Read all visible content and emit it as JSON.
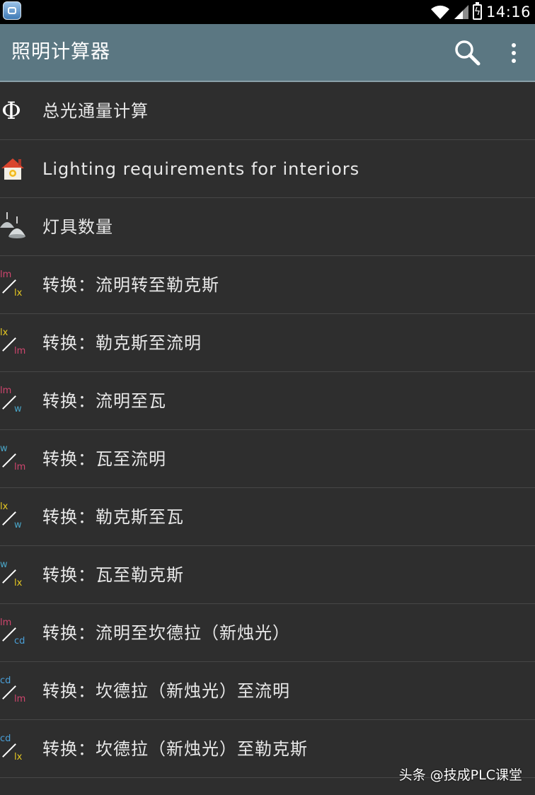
{
  "status_bar": {
    "time": "14:16"
  },
  "action_bar": {
    "title": "照明计算器"
  },
  "colors": {
    "lm": "#d0466e",
    "lx": "#e6c822",
    "w": "#4aa6c8",
    "cd": "#4a9fd8"
  },
  "items": [
    {
      "label": "总光通量计算",
      "icon": "phi-icon"
    },
    {
      "label": "Lighting requirements for interiors",
      "icon": "house-icon"
    },
    {
      "label": "灯具数量",
      "icon": "lamp-icon"
    },
    {
      "label": "转换：流明转至勒克斯",
      "icon": "lm-to-lx-icon",
      "from": "lm",
      "to": "lx"
    },
    {
      "label": "转换：勒克斯至流明",
      "icon": "lx-to-lm-icon",
      "from": "lx",
      "to": "lm"
    },
    {
      "label": "转换：流明至瓦",
      "icon": "lm-to-w-icon",
      "from": "lm",
      "to": "w"
    },
    {
      "label": "转换：瓦至流明",
      "icon": "w-to-lm-icon",
      "from": "w",
      "to": "lm"
    },
    {
      "label": "转换：勒克斯至瓦",
      "icon": "lx-to-w-icon",
      "from": "lx",
      "to": "w"
    },
    {
      "label": "转换：瓦至勒克斯",
      "icon": "w-to-lx-icon",
      "from": "w",
      "to": "lx"
    },
    {
      "label": "转换：流明至坎德拉（新烛光）",
      "icon": "lm-to-cd-icon",
      "from": "lm",
      "to": "cd"
    },
    {
      "label": "转换：坎德拉（新烛光）至流明",
      "icon": "cd-to-lm-icon",
      "from": "cd",
      "to": "lm"
    },
    {
      "label": "转换：坎德拉（新烛光）至勒克斯",
      "icon": "cd-to-lx-icon",
      "from": "cd",
      "to": "lx"
    }
  ],
  "watermark": "头条 @技成PLC课堂"
}
